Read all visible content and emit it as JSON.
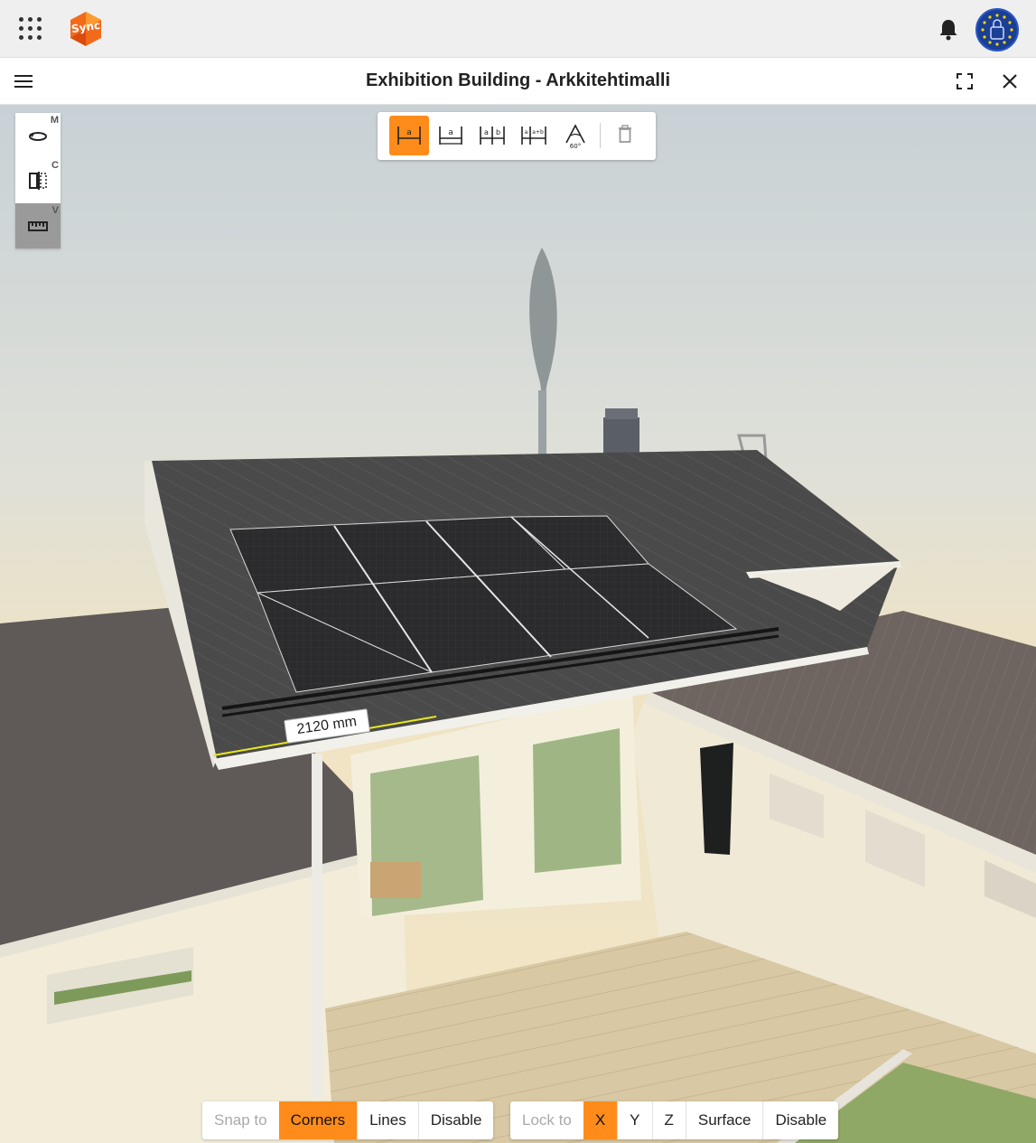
{
  "app": {
    "logo_text": "Sync",
    "icons": {
      "apps": "apps-grid-icon",
      "notifications": "bell-icon",
      "avatar": "eu-lock-avatar-icon"
    }
  },
  "header": {
    "title": "Exhibition Building - Arkkitehtimalli",
    "icons": {
      "menu": "hamburger-menu-icon",
      "fullscreen": "fullscreen-icon",
      "close": "close-icon"
    }
  },
  "tools": [
    {
      "name": "orbit",
      "icon": "orbit-icon",
      "shortcut": "M",
      "active": false
    },
    {
      "name": "clip",
      "icon": "section-clip-icon",
      "shortcut": "C",
      "active": false
    },
    {
      "name": "measure",
      "icon": "ruler-icon",
      "shortcut": "V",
      "active": true
    }
  ],
  "measure_toolbar": {
    "buttons": [
      {
        "name": "distance",
        "icon": "distance-measure-icon",
        "label": "a",
        "active": true
      },
      {
        "name": "dimension",
        "icon": "dimension-measure-icon",
        "label": "a",
        "active": false
      },
      {
        "name": "chained",
        "icon": "chained-measure-icon",
        "label": "a b",
        "active": false
      },
      {
        "name": "cumulative",
        "icon": "cumulative-measure-icon",
        "label": "a a+b",
        "active": false
      },
      {
        "name": "angle",
        "icon": "angle-measure-icon",
        "label": "60°",
        "active": false
      }
    ],
    "delete_icon": "trash-icon"
  },
  "measurement": {
    "value": "2120 mm"
  },
  "snap": {
    "label": "Snap to",
    "options": [
      "Corners",
      "Lines",
      "Disable"
    ],
    "selected": "Corners"
  },
  "lock": {
    "label": "Lock to",
    "options": [
      "X",
      "Y",
      "Z",
      "Surface",
      "Disable"
    ],
    "selected": "X"
  },
  "colors": {
    "accent": "#ff8c1a",
    "roof": "#4a4a4a",
    "wall": "#f0ead6",
    "deck": "#d9c9a8"
  }
}
